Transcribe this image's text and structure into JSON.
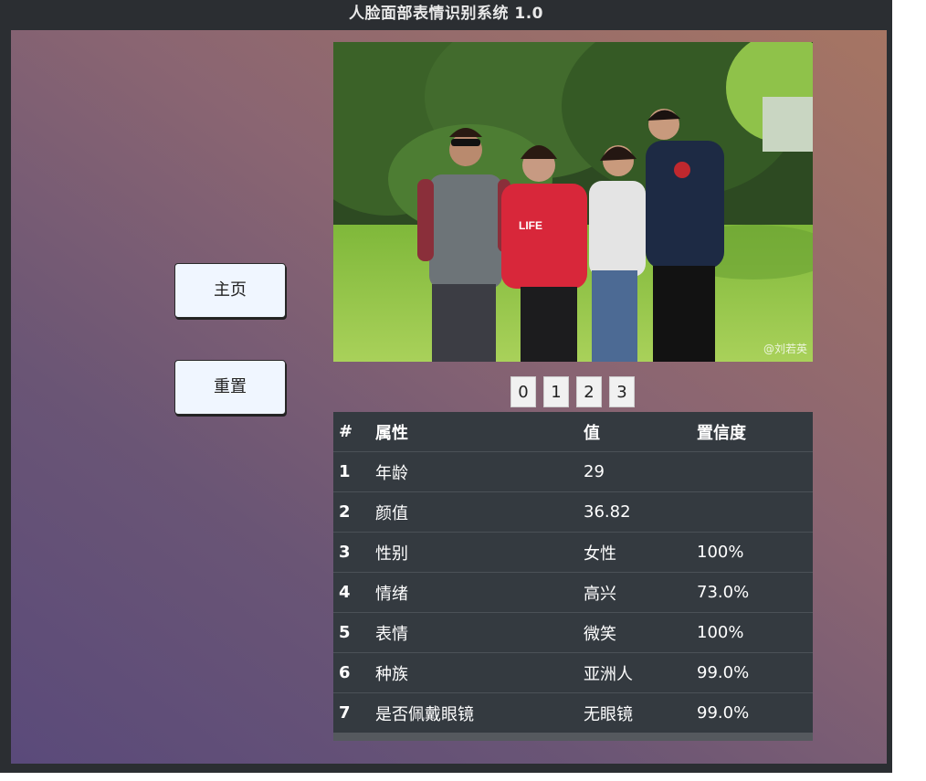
{
  "window": {
    "title": "人脸面部表情识别系统 1.0"
  },
  "sidebar": {
    "home_label": "主页",
    "reset_label": "重置"
  },
  "image": {
    "watermark": "@刘若英"
  },
  "face_tabs": [
    "0",
    "1",
    "2",
    "3"
  ],
  "results_table": {
    "headers": {
      "index": "#",
      "attribute": "属性",
      "value": "值",
      "confidence": "置信度"
    },
    "rows": [
      {
        "index": "1",
        "attribute": "年龄",
        "value": "29",
        "confidence": ""
      },
      {
        "index": "2",
        "attribute": "颜值",
        "value": "36.82",
        "confidence": ""
      },
      {
        "index": "3",
        "attribute": "性别",
        "value": "女性",
        "confidence": "100%"
      },
      {
        "index": "4",
        "attribute": "情绪",
        "value": "高兴",
        "confidence": "73.0%"
      },
      {
        "index": "5",
        "attribute": "表情",
        "value": "微笑",
        "confidence": "100%"
      },
      {
        "index": "6",
        "attribute": "种族",
        "value": "亚洲人",
        "confidence": "99.0%"
      },
      {
        "index": "7",
        "attribute": "是否佩戴眼镜",
        "value": "无眼镜",
        "confidence": "99.0%"
      }
    ]
  },
  "colors": {
    "titlebar_bg": "#2b2e32",
    "button_bg": "#f0f6ff",
    "table_bg": "#343a40"
  }
}
